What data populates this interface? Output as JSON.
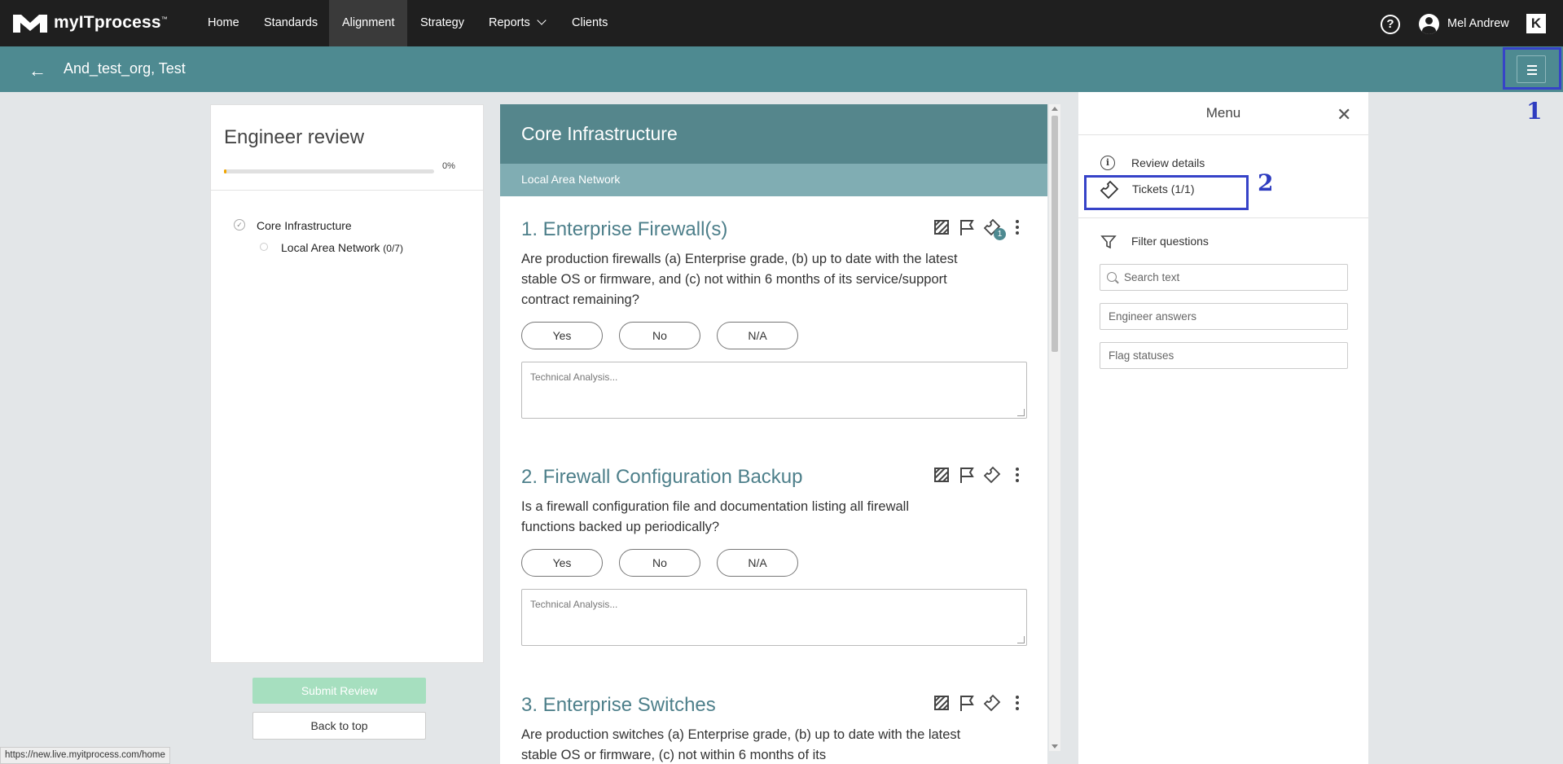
{
  "topnav": {
    "logo_text": "myITprocess",
    "logo_tm": "™",
    "items": [
      {
        "label": "Home"
      },
      {
        "label": "Standards"
      },
      {
        "label": "Alignment"
      },
      {
        "label": "Strategy"
      },
      {
        "label": "Reports"
      },
      {
        "label": "Clients"
      }
    ],
    "active": "Alignment",
    "help_glyph": "?",
    "user_name": "Mel Andrew",
    "app_switch_glyph": "K"
  },
  "subheader": {
    "back_glyph": "←",
    "title": "And_test_org, Test"
  },
  "annotations": {
    "one": "1",
    "two": "2"
  },
  "left_panel": {
    "title": "Engineer review",
    "progress": {
      "percent": 0,
      "label": "0%"
    },
    "tree": [
      {
        "label": "Core Infrastructure"
      },
      {
        "label": "Local Area Network",
        "count": "(0/7)"
      }
    ],
    "check_glyph": "✓",
    "submit_label": "Submit Review",
    "back_to_top_label": "Back to top"
  },
  "status_url": "https://new.live.myitprocess.com/home",
  "center": {
    "section_title": "Core Infrastructure",
    "subsection_title": "Local Area Network",
    "analysis_placeholder": "Technical Analysis...",
    "answer_labels": [
      "Yes",
      "No",
      "N/A"
    ],
    "questions": [
      {
        "title": "1. Enterprise Firewall(s)",
        "text": "Are production firewalls (a) Enterprise grade, (b) up to date with the latest stable OS or firmware, and (c) not within 6 months of its service/support contract remaining?",
        "ticket_badge": "1"
      },
      {
        "title": "2. Firewall Configuration Backup",
        "text": "Is a firewall configuration file and documentation listing all firewall functions backed up periodically?",
        "ticket_badge": ""
      },
      {
        "title": "3. Enterprise Switches",
        "text": "Are production switches (a) Enterprise grade, (b) up to date with the latest stable OS or firmware, (c) not within 6 months of its",
        "ticket_badge": ""
      }
    ]
  },
  "right_panel": {
    "menu_title": "Menu",
    "close_glyph": "✕",
    "info_glyph": "i",
    "review_details_label": "Review details",
    "tickets_label": "Tickets (1/1)",
    "filter_label": "Filter questions",
    "search_placeholder": "Search text",
    "engineer_answers_placeholder": "Engineer answers",
    "flag_statuses_placeholder": "Flag statuses"
  },
  "colors": {
    "topnav_bg": "#1f1f1f",
    "subheader_bg": "#4e8a91",
    "section_header_bg": "#55868c",
    "subsection_bg": "#80adb3",
    "question_title": "#4d7f8a",
    "submit_disabled": "#a6dfbf",
    "progress_fill": "#f0a500",
    "annotation_blue": "#3643c8"
  }
}
